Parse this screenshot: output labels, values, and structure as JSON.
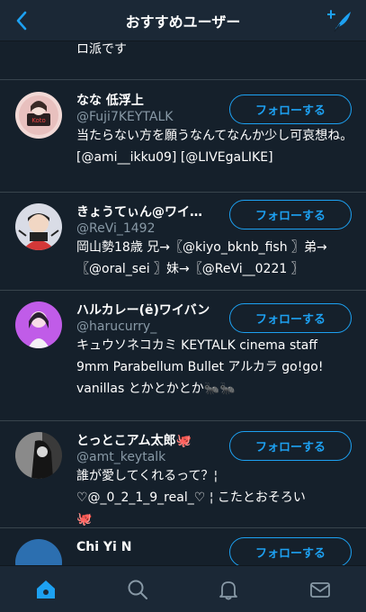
{
  "header": {
    "title": "おすすめユーザー"
  },
  "partial_top_text": "ロ派です",
  "follow_label": "フォローする",
  "users": [
    {
      "name": "なな 低浮上",
      "handle": "@Fuji7KEYTALK",
      "bio": "当たらない方を願うなんてなんか少し可哀想ね。 [@ami__ikku09] [@LIVEgaLIKE]"
    },
    {
      "name": "きょうてぃん@ワイ…",
      "handle": "@ReVi_1492",
      "bio": "岡山勢18歳 兄→〖@kiyo_bknb_fish 〗弟→〖@oral_sei 〗妹→〖@ReVi__0221 〗"
    },
    {
      "name": "ハルカレー(ё)ワイバン",
      "handle": "@harucurry_",
      "bio": "キュウソネコカミ KEYTALK cinema staff 9mm Parabellum Bullet アルカラ go!go! vanillas とかとかとか🐜🐜"
    },
    {
      "name": "とっとこアム太郎🐙",
      "handle": "@amt_keytalk",
      "bio": "誰が愛してくれるって？¦ ♡@_0_2_1_9_real_♡ ¦ こたとおそろい🐙"
    },
    {
      "name": "Chi  Yi   N   ",
      "handle": "",
      "bio": ""
    }
  ],
  "colors": {
    "background": "#15202b",
    "accent": "#1da1f2",
    "muted": "#8899a6",
    "divider": "#38444d"
  },
  "tabs": [
    {
      "name": "home-icon",
      "active": true
    },
    {
      "name": "search-icon",
      "active": false
    },
    {
      "name": "notifications-icon",
      "active": false
    },
    {
      "name": "messages-icon",
      "active": false
    }
  ]
}
